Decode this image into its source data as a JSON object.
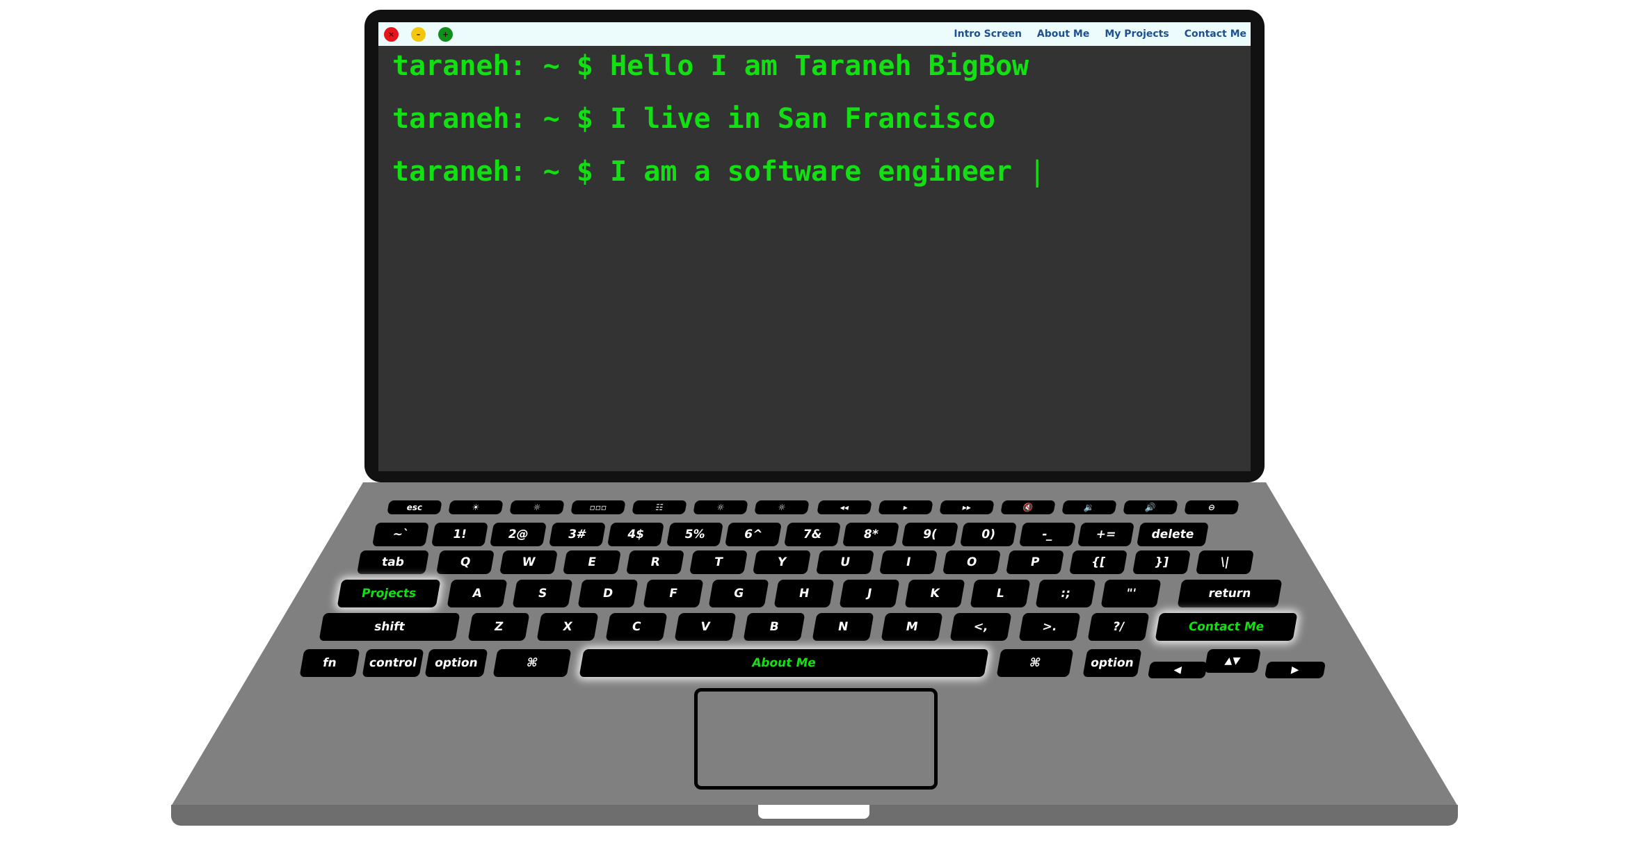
{
  "window": {
    "controls": [
      "×",
      "–",
      "+"
    ],
    "nav": [
      "Intro Screen",
      "About Me",
      "My Projects",
      "Contact Me"
    ]
  },
  "terminal": {
    "lines": [
      "taraneh: ~ $ Hello I am Taraneh BigBow",
      "taraneh: ~ $ I live in San Francisco",
      "taraneh: ~ $ I am a software engineer"
    ],
    "cursor": "|",
    "text_color": "#12e012",
    "background": "#333333"
  },
  "keyboard": {
    "fn_row": [
      "esc",
      "☀",
      "☼",
      "▫▫▫",
      "☷",
      "☼",
      "☼",
      "◂◂",
      "▸",
      "▸▸",
      "🔇",
      "🔉",
      "🔊",
      "⊖"
    ],
    "number_row": [
      "~`",
      "1!",
      "2@",
      "3#",
      "4$",
      "5%",
      "6^",
      "7&",
      "8*",
      "9(",
      "0)",
      "-_",
      "+=",
      "delete"
    ],
    "q_row": [
      "tab",
      "Q",
      "W",
      "E",
      "R",
      "T",
      "Y",
      "U",
      "I",
      "O",
      "P",
      "{[",
      "}]",
      "\\|"
    ],
    "a_row": [
      "Projects",
      "A",
      "S",
      "D",
      "F",
      "G",
      "H",
      "J",
      "K",
      "L",
      ":;",
      "\"'",
      "return"
    ],
    "z_row": [
      "shift",
      "Z",
      "X",
      "C",
      "V",
      "B",
      "N",
      "M",
      "<,",
      ">.",
      "?/",
      "Contact Me"
    ],
    "bottom_row": [
      "fn",
      "control",
      "option",
      "⌘",
      "About Me",
      "⌘",
      "option"
    ],
    "arrows": [
      "◀",
      "▲▼",
      "▶"
    ],
    "highlight_color": "#12e012"
  }
}
